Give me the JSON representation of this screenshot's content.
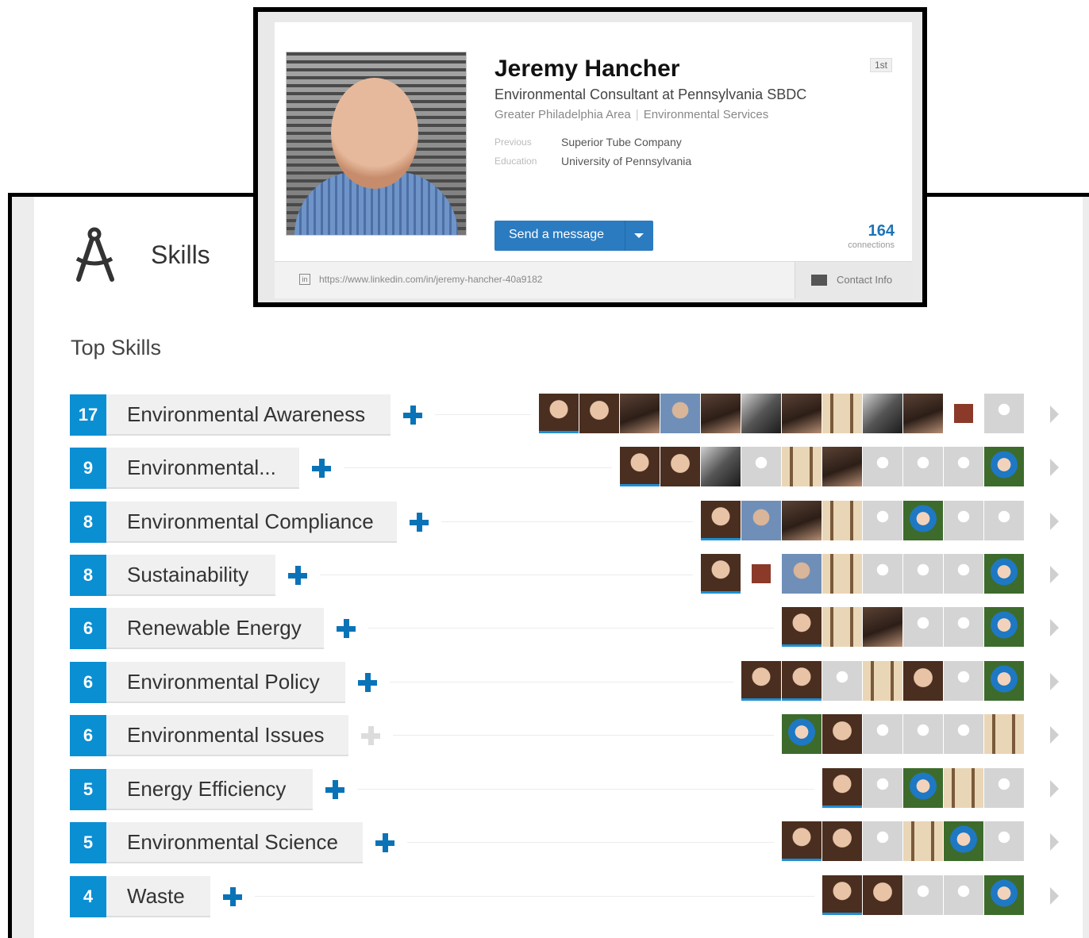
{
  "profile": {
    "name": "Jeremy Hancher",
    "headline": "Environmental Consultant at Pennsylvania SBDC",
    "location": "Greater Philadelphia Area",
    "industry": "Environmental Services",
    "previous_label": "Previous",
    "previous_value": "Superior Tube Company",
    "education_label": "Education",
    "education_value": "University of Pennsylvania",
    "degree_badge": "1st",
    "send_button": "Send a message",
    "connections_count": "164",
    "connections_label": "connections",
    "profile_url": "https://www.linkedin.com/in/jeremy-hancher-40a9182",
    "contact_info": "Contact Info"
  },
  "skills": {
    "section_title": "Skills",
    "top_skills_label": "Top Skills",
    "items": [
      {
        "count": "17",
        "name": "Environmental Awareness",
        "plus_enabled": true
      },
      {
        "count": "9",
        "name": "Environmental...",
        "plus_enabled": true
      },
      {
        "count": "8",
        "name": "Environmental Compliance",
        "plus_enabled": true
      },
      {
        "count": "8",
        "name": "Sustainability",
        "plus_enabled": true
      },
      {
        "count": "6",
        "name": "Renewable Energy",
        "plus_enabled": true
      },
      {
        "count": "6",
        "name": "Environmental Policy",
        "plus_enabled": true
      },
      {
        "count": "6",
        "name": "Environmental Issues",
        "plus_enabled": false
      },
      {
        "count": "5",
        "name": "Energy Efficiency",
        "plus_enabled": true
      },
      {
        "count": "5",
        "name": "Environmental Science",
        "plus_enabled": true
      },
      {
        "count": "4",
        "name": "Waste",
        "plus_enabled": true
      }
    ]
  },
  "colors": {
    "accent_blue": "#0a8fd3",
    "plus_blue": "#0a73b7",
    "button_blue": "#2b7bc0",
    "connections_blue": "#1d74b7"
  },
  "icons": [
    "drafting-compass-icon",
    "plus-icon",
    "chevron-right-icon",
    "linkedin-icon",
    "contact-card-icon",
    "dropdown-caret-icon"
  ]
}
